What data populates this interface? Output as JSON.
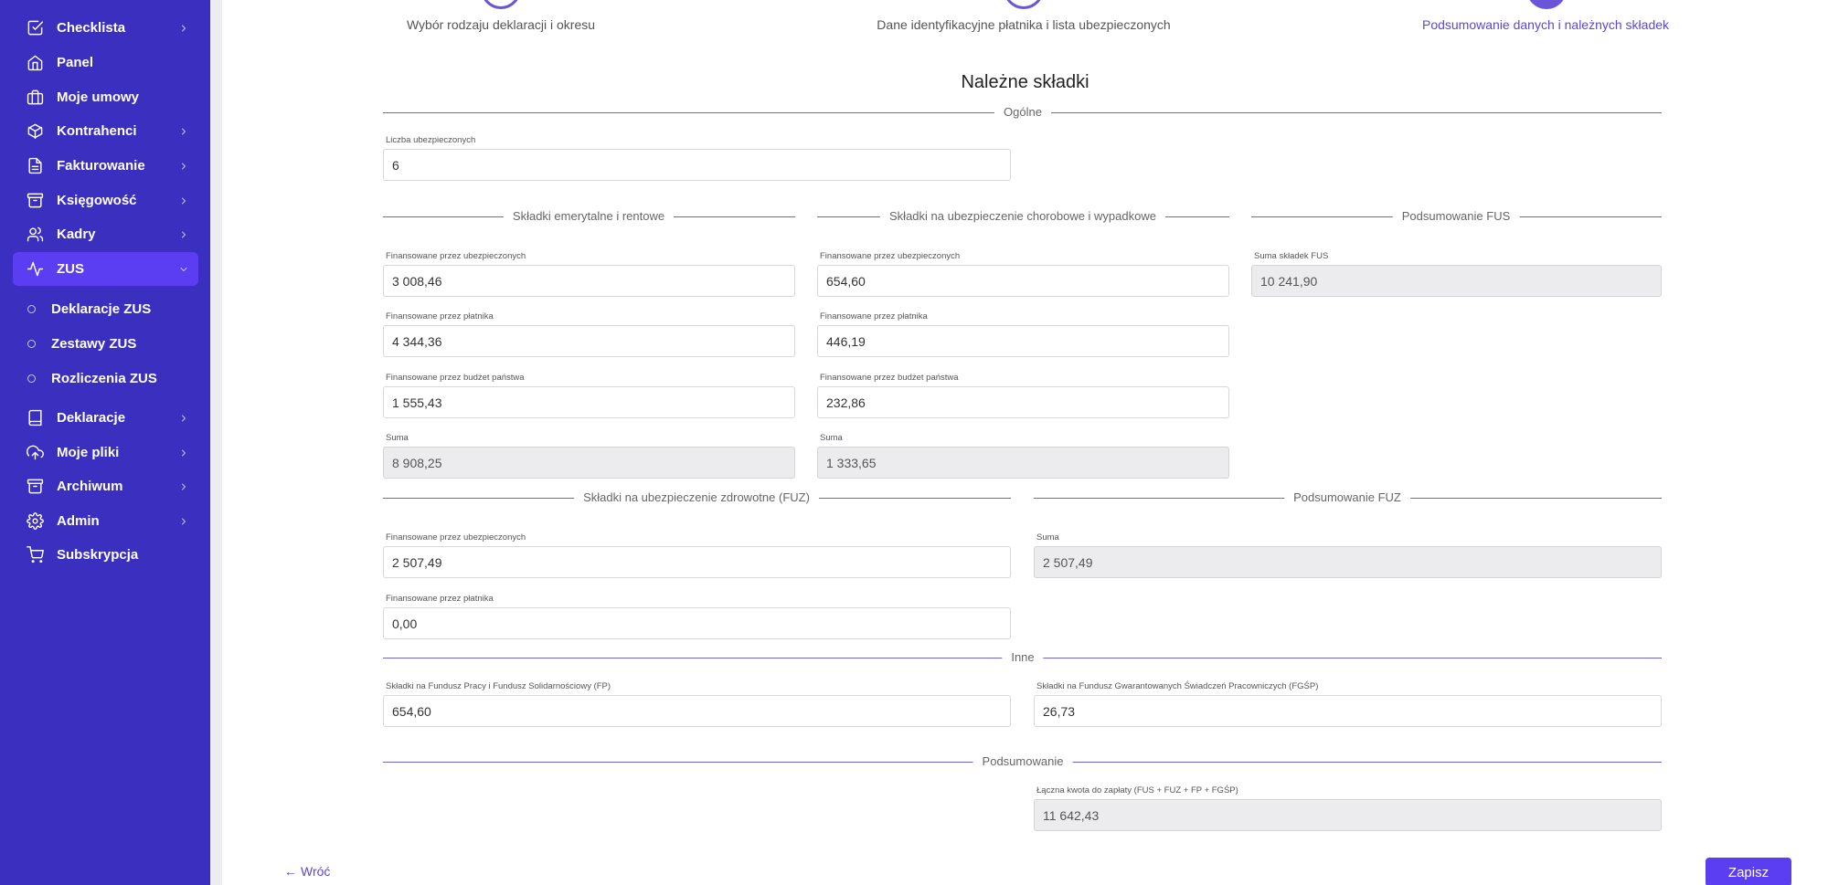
{
  "sidebar": {
    "items": [
      {
        "label": "Checklista",
        "icon": "checkbox-icon"
      },
      {
        "label": "Panel",
        "icon": "home-icon"
      },
      {
        "label": "Moje umowy",
        "icon": "briefcase-icon"
      },
      {
        "label": "Kontrahenci",
        "icon": "box-icon"
      },
      {
        "label": "Fakturowanie",
        "icon": "document-icon"
      },
      {
        "label": "Księgowość",
        "icon": "archive-icon"
      },
      {
        "label": "Kadry",
        "icon": "users-icon"
      },
      {
        "label": "ZUS",
        "icon": "activity-icon"
      },
      {
        "label": "Deklaracje",
        "icon": "book-icon"
      },
      {
        "label": "Moje pliki",
        "icon": "cloud-upload-icon"
      },
      {
        "label": "Archiwum",
        "icon": "archive-box-icon"
      },
      {
        "label": "Admin",
        "icon": "gear-icon"
      },
      {
        "label": "Subskrypcja",
        "icon": "cart-icon"
      }
    ],
    "zus_sub": [
      {
        "label": "Deklaracje ZUS"
      },
      {
        "label": "Zestawy ZUS"
      },
      {
        "label": "Rozliczenia ZUS"
      }
    ]
  },
  "steps": [
    {
      "label": "Wybór rodzaju deklaracji i okresu"
    },
    {
      "label": "Dane identyfikacyjne płatnika i lista ubezpieczonych"
    },
    {
      "label": "Podsumowanie danych i należnych składek"
    }
  ],
  "title": "Należne składki",
  "sections": {
    "general": "Ogólne",
    "pension": "Składki emerytalne i rentowe",
    "sickness": "Składki na ubezpieczenie chorobowe i wypadkowe",
    "fus_summary": "Podsumowanie FUS",
    "health": "Składki na ubezpieczenie zdrowotne (FUZ)",
    "fuz_summary": "Podsumowanie FUZ",
    "other": "Inne",
    "summary": "Podsumowanie"
  },
  "labels": {
    "insured_count": "Liczba ubezpieczonych",
    "by_insured": "Finansowane przez ubezpieczonych",
    "by_payer": "Finansowane przez płatnika",
    "by_budget": "Finansowane przez budżet państwa",
    "sum": "Suma",
    "fus_sum": "Suma składek FUS",
    "fp": "Składki na Fundusz Pracy i Fundusz Solidarnościowy (FP)",
    "fgsp": "Składki na Fundusz Gwarantowanych Świadczeń Pracowniczych (FGŚP)",
    "total": "Łączna kwota do zapłaty (FUS + FUZ + FP + FGŚP)"
  },
  "values": {
    "insured_count": "6",
    "pension_insured": "3 008,46",
    "pension_payer": "4 344,36",
    "pension_budget": "1 555,43",
    "pension_sum": "8 908,25",
    "sickness_insured": "654,60",
    "sickness_payer": "446,19",
    "sickness_budget": "232,86",
    "sickness_sum": "1 333,65",
    "fus_sum": "10 241,90",
    "health_insured": "2 507,49",
    "health_payer": "0,00",
    "fuz_sum": "2 507,49",
    "fp": "654,60",
    "fgsp": "26,73",
    "total": "11 642,43"
  },
  "footer": {
    "back": "Wróć",
    "save": "Zapisz"
  }
}
